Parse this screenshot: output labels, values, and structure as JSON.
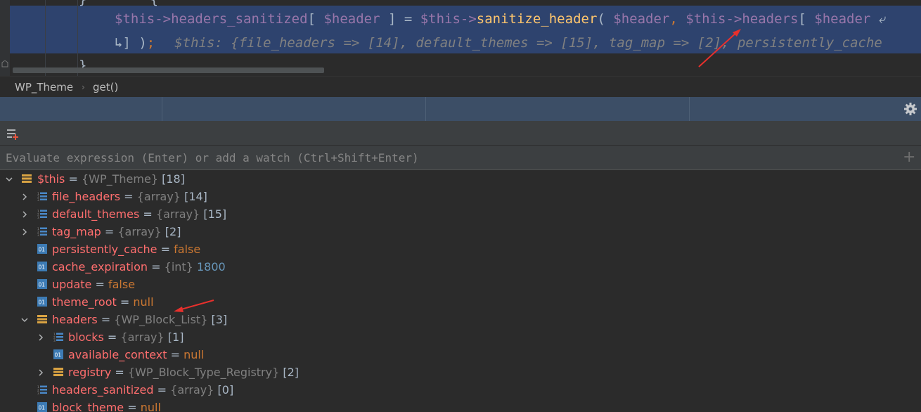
{
  "editor": {
    "line1_prefix": "$this->",
    "line1_prop": "headers_sanitized",
    "line1_b1": "[ ",
    "line1_var1": "$header",
    "line1_b2": " ] = ",
    "line1_this2": "$this->",
    "line1_fn": "sanitize_header",
    "line1_p1": "( ",
    "line1_var2": "$header",
    "line1_comma": ", ",
    "line1_this3": "$this->",
    "line1_headers": "headers",
    "line1_b3": "[ ",
    "line1_var3": "$header",
    "line1_trail": " ⤶",
    "line2_wrap": "↳",
    "line2_code": "] )",
    "line2_semi": ";",
    "inline_hint": "$this: {file_headers => [14], default_themes => [15], tag_map => [2], persistently_cache",
    "line3": "}"
  },
  "breadcrumb": {
    "class_name": "WP_Theme",
    "separator": "›",
    "method": "get()"
  },
  "evaluate": {
    "placeholder": "Evaluate expression (Enter) or add a watch (Ctrl+Shift+Enter)",
    "value": ""
  },
  "tree": [
    {
      "name": "$this",
      "type": "{WP_Theme}",
      "count": "[18]"
    },
    {
      "name": "file_headers",
      "type": "{array}",
      "count": "[14]"
    },
    {
      "name": "default_themes",
      "type": "{array}",
      "count": "[15]"
    },
    {
      "name": "tag_map",
      "type": "{array}",
      "count": "[2]"
    },
    {
      "name": "persistently_cache",
      "value": "false"
    },
    {
      "name": "cache_expiration",
      "type": "{int}",
      "value": "1800"
    },
    {
      "name": "update",
      "value": "false"
    },
    {
      "name": "theme_root",
      "value": "null"
    },
    {
      "name": "headers",
      "type": "{WP_Block_List}",
      "count": "[3]"
    },
    {
      "name": "blocks",
      "type": "{array}",
      "count": "[1]"
    },
    {
      "name": "available_context",
      "value": "null"
    },
    {
      "name": "registry",
      "type": "{WP_Block_Type_Registry}",
      "count": "[2]"
    },
    {
      "name": "headers_sanitized",
      "type": "{array}",
      "count": "[0]"
    },
    {
      "name": "block_theme",
      "value": "null"
    }
  ],
  "tree_equals": "=",
  "colors": {
    "selection": "#2e436e",
    "var_name": "#ff6e6e",
    "keyword": "#cc7832",
    "number": "#6897bb",
    "annotation_arrow": "#e8302c"
  }
}
